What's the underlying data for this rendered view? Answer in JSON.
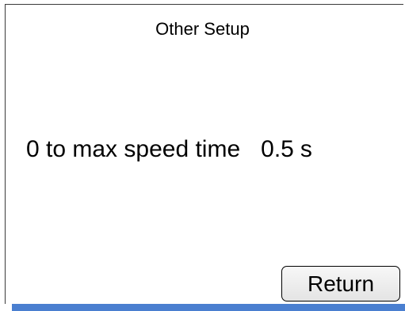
{
  "screen": {
    "title": "Other Setup"
  },
  "setting": {
    "label": "0 to max speed time",
    "value": "0.5",
    "unit": "s"
  },
  "buttons": {
    "return_label": "Return"
  },
  "colors": {
    "background": "#ffffff",
    "accent_bar": "#4a7fd0",
    "text": "#000000"
  }
}
